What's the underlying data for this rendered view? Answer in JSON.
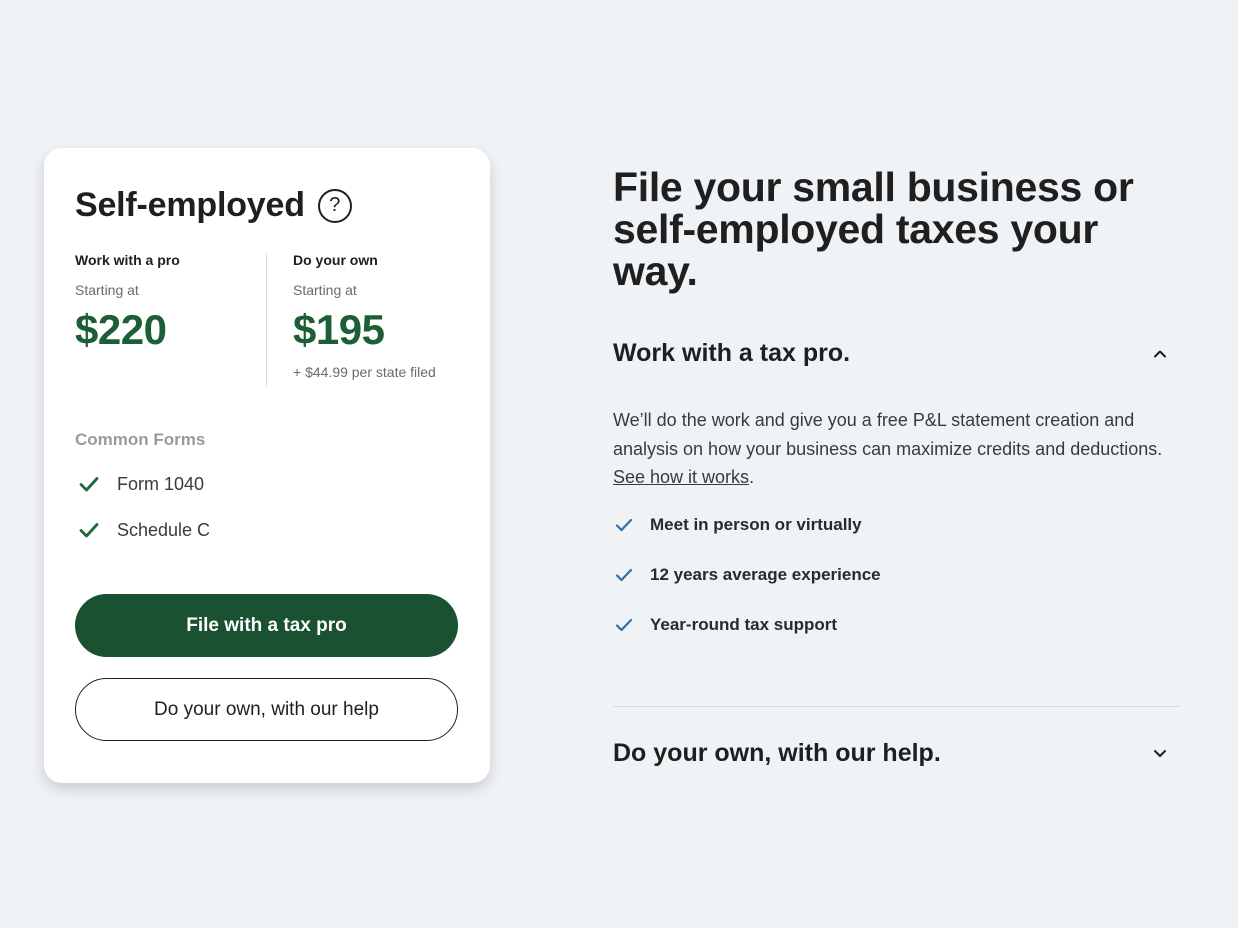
{
  "card": {
    "title": "Self-employed",
    "help_icon": "question-circle-icon",
    "left_col": {
      "label": "Work with a pro",
      "starting": "Starting at",
      "price": "$220"
    },
    "right_col": {
      "label": "Do your own",
      "starting": "Starting at",
      "price": "$195",
      "state_fee": "+ $44.99 per state filed"
    },
    "forms_heading": "Common Forms",
    "forms": [
      "Form 1040",
      "Schedule C"
    ],
    "primary_button": "File with a tax pro",
    "secondary_button": "Do your own, with our help"
  },
  "main": {
    "headline": "File your small business or self-employed taxes your way.",
    "accordion": [
      {
        "title": "Work with a tax pro.",
        "expanded": true,
        "body_text": "We’ll do the work and give you a free P&L statement creation and analysis on how your business can maximize credits and deductions.",
        "link_text": "See how it works",
        "body_suffix": ".",
        "features": [
          "Meet in person or virtually",
          "12 years average experience",
          "Year-round tax support"
        ]
      },
      {
        "title": "Do your own, with our help.",
        "expanded": false
      }
    ]
  },
  "colors": {
    "brand_green": "#1a5130",
    "price_green": "#1c5e35",
    "check_green": "#1c6b3a",
    "check_blue": "#2f6fa7",
    "background": "#f0f3f6"
  }
}
